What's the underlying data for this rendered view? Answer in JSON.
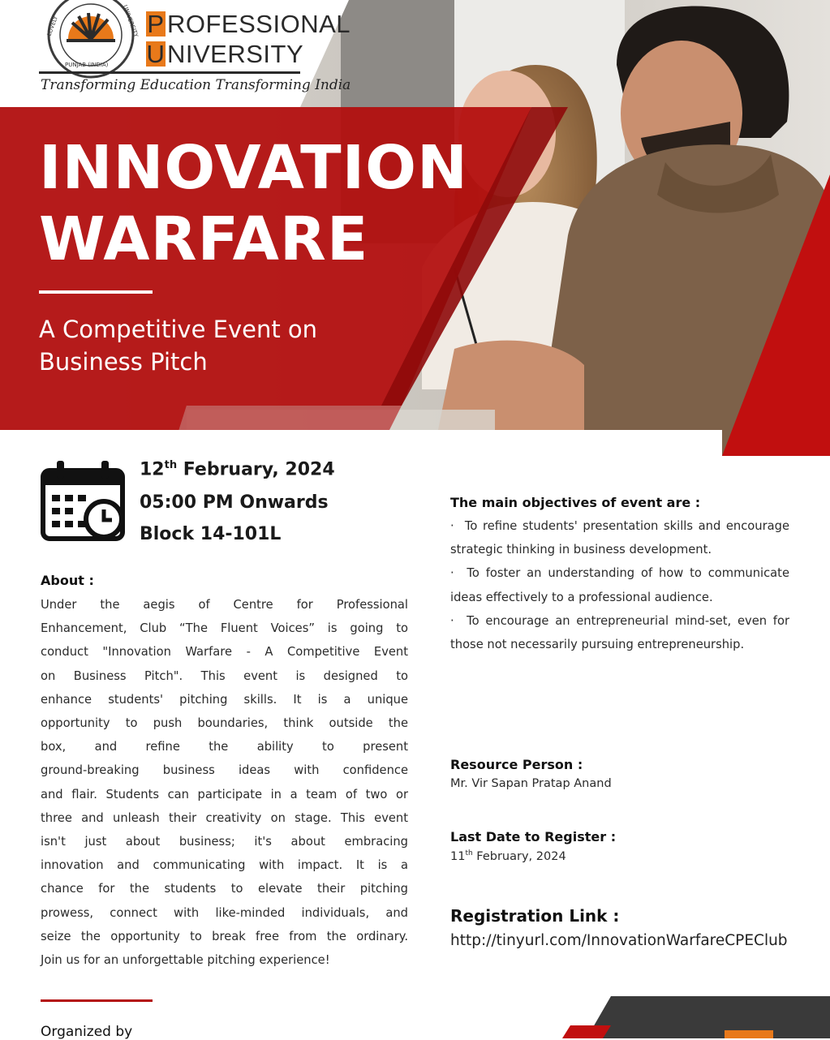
{
  "brand": {
    "seal_text_left": "LOVELY",
    "seal_text_right": "UNIVERSITY",
    "seal_text_bottom": "PUNJAB (INDIA)",
    "word1_cap": "P",
    "word1_rest": "ROFESSIONAL",
    "word2_cap": "U",
    "word2_rest": "NIVERSITY",
    "tagline": "Transforming Education Transforming India"
  },
  "hero": {
    "title_line1": "INNOVATION",
    "title_line2": "WARFARE",
    "subtitle_line1": "A Competitive Event on",
    "subtitle_line2": "Business Pitch"
  },
  "event": {
    "day": "12",
    "day_suffix": "th",
    "month_year": " February, 2024",
    "time": "05:00 PM Onwards",
    "venue": "Block 14-101L"
  },
  "about": {
    "heading": "About :",
    "lines": [
      "Under the aegis of Centre for Professional",
      "Enhancement, Club “The Fluent Voices” is going to",
      "conduct \"Innovation Warfare - A Competitive Event",
      "on Business Pitch\".  This event is designed to",
      "enhance students' pitching skills. It is a unique",
      "opportunity to push boundaries, think outside the",
      "box, and refine the ability to present",
      "ground-breaking business ideas with confidence",
      "and flair. Students can participate in a team of two or",
      "three and unleash their creativity on stage. This event",
      "isn't just about business; it's about embracing",
      "innovation and communicating with impact. It is a",
      "chance for the students to elevate their pitching",
      "prowess, connect with like-minded individuals, and",
      "seize the opportunity to break free from the ordinary.",
      "Join us for an unforgettable pitching experience!"
    ]
  },
  "objectives": {
    "heading": "The main objectives of event are :",
    "items": [
      "To refine students' presentation skills and encourage strategic thinking in business development.",
      "To foster an understanding of how to communicate ideas effectively to a professional audience.",
      "To encourage an entrepreneurial mind-set, even for those not necessarily pursuing entrepreneurship."
    ]
  },
  "resource": {
    "heading": "Resource Person :",
    "name": "Mr. Vir Sapan Pratap Anand"
  },
  "deadline": {
    "heading": "Last Date to Register :",
    "day": "11",
    "day_suffix": "th",
    "month_year": " February, 2024"
  },
  "registration": {
    "heading": "Registration Link :",
    "url": "http://tinyurl.com/InnovationWarfareCPEClub"
  },
  "footer": {
    "organized_by": "Organized by"
  },
  "colors": {
    "brand_red": "#b30d0d",
    "dark_red": "#8e0a0a",
    "orange": "#e8791a",
    "dark_slate": "#3a3a3a"
  }
}
